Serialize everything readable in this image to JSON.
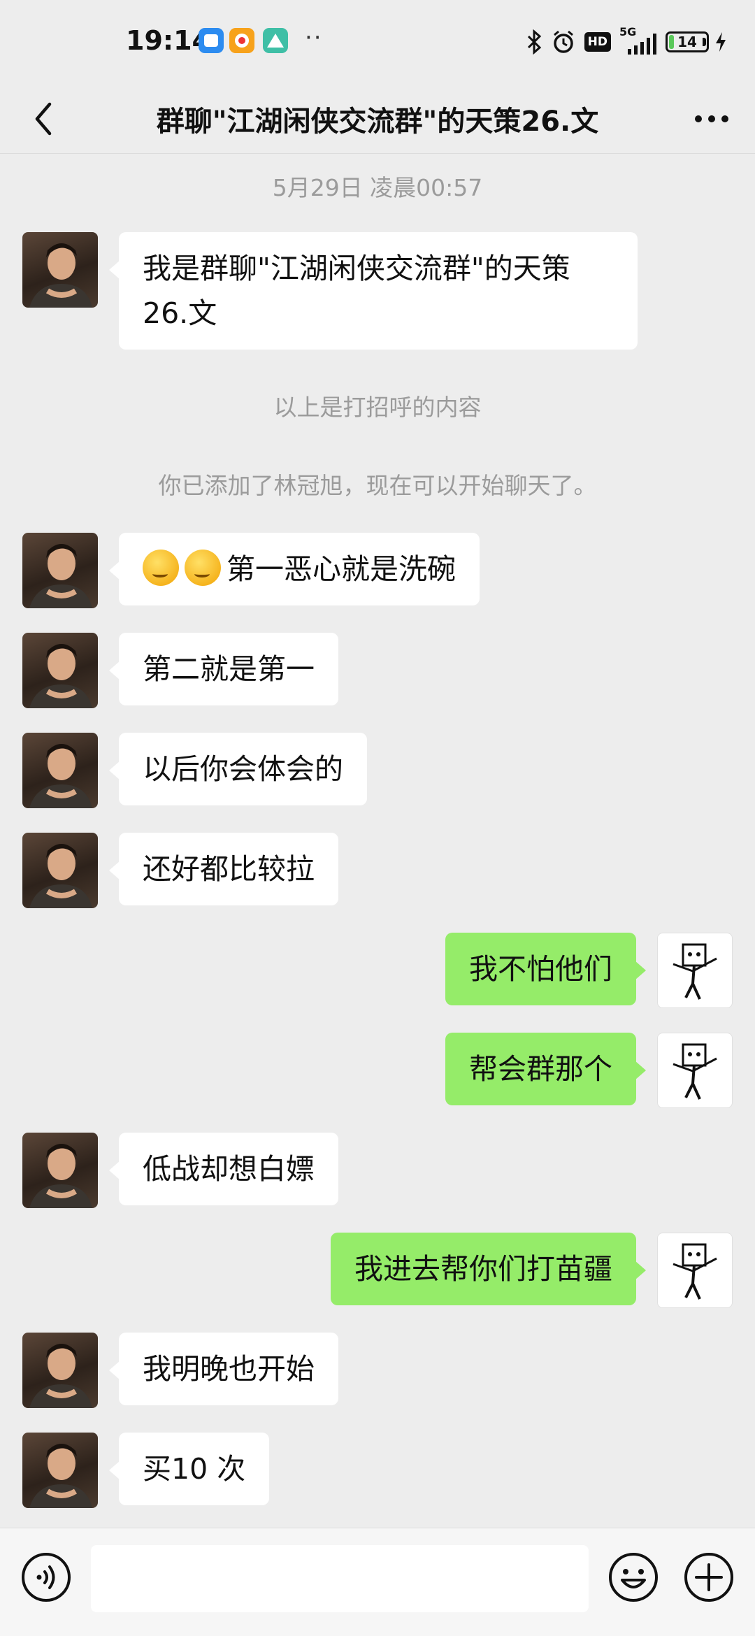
{
  "status": {
    "time": "19:14",
    "dots": "··",
    "network": "5G",
    "hd": "HD",
    "battery": "14",
    "battery_level": 0.14
  },
  "header": {
    "title": "群聊\"江湖闲侠交流群\"的天策26.文"
  },
  "chat": {
    "timestamp": "5月29日 凌晨00:57",
    "greeting_note": "以上是打招呼的内容",
    "added_note": "你已添加了林冠旭，现在可以开始聊天了。",
    "messages": [
      {
        "side": "left",
        "text": "我是群聊\"江湖闲侠交流群\"的天策26.文"
      },
      {
        "side": "left",
        "text": "第一恶心就是洗碗"
      },
      {
        "side": "left",
        "text": "第二就是第一"
      },
      {
        "side": "left",
        "text": "以后你会体会的"
      },
      {
        "side": "left",
        "text": "还好都比较拉"
      },
      {
        "side": "right",
        "text": "我不怕他们"
      },
      {
        "side": "right",
        "text": "帮会群那个"
      },
      {
        "side": "left",
        "text": "低战却想白嫖"
      },
      {
        "side": "right",
        "text": "我进去帮你们打苗疆"
      },
      {
        "side": "left",
        "text": "我明晚也开始"
      },
      {
        "side": "left",
        "text": "买10 次"
      }
    ]
  },
  "icons": {
    "back": "chevron-left-icon",
    "more": "more-icon",
    "voice": "voice-icon",
    "emoji": "emoji-icon",
    "plus": "plus-icon"
  },
  "colors": {
    "background": "#ededed",
    "bubble_left": "#ffffff",
    "bubble_right": "#95ec69",
    "system_text": "#9b9b9b"
  }
}
